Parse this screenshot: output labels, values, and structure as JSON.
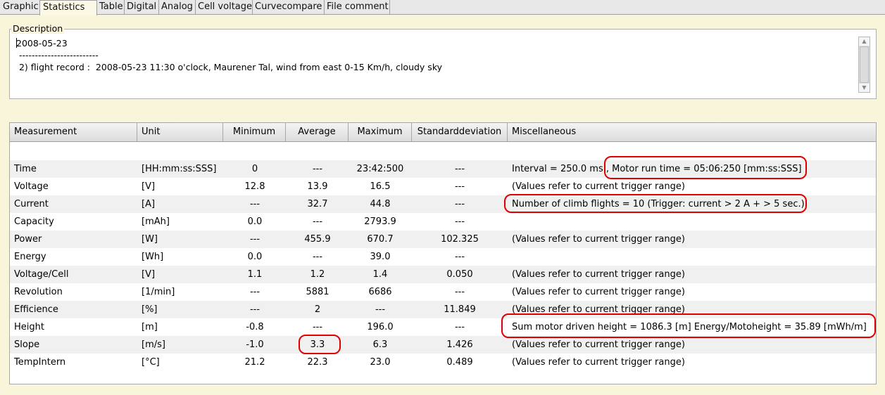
{
  "tabs": [
    {
      "label": "Graphic"
    },
    {
      "label": "Statistics"
    },
    {
      "label": "Table"
    },
    {
      "label": "Digital"
    },
    {
      "label": "Analog"
    },
    {
      "label": "Cell voltage"
    },
    {
      "label": "Curvecompare"
    },
    {
      "label": "File comment"
    }
  ],
  "active_tab": "Statistics",
  "description": {
    "legend": "Description",
    "text": "2008-05-23\n -------------------------\n 2) flight record :  2008-05-23 11:30 o'clock, Maurener Tal, wind from east 0-15 Km/h, cloudy sky"
  },
  "table": {
    "headers": [
      "Measurement",
      "Unit",
      "Minimum",
      "Average",
      "Maximum",
      "Standarddeviation",
      "Miscellaneous"
    ],
    "rows": [
      {
        "measurement": "Time",
        "unit": "[HH:mm:ss:SSS]",
        "min": "0",
        "avg": "---",
        "max": "23:42:500",
        "std": "---",
        "misc": "Interval =  250.0 ms , Motor run time = 05:06:250 [mm:ss:SSS]"
      },
      {
        "measurement": "Voltage",
        "unit": "[V]",
        "min": "12.8",
        "avg": "13.9",
        "max": "16.5",
        "std": "---",
        "misc": "(Values refer to current trigger range)"
      },
      {
        "measurement": "Current",
        "unit": "[A]",
        "min": "---",
        "avg": "32.7",
        "max": "44.8",
        "std": "---",
        "misc": "Number of climb flights = 10 (Trigger: current > 2 A + > 5 sec.)"
      },
      {
        "measurement": "Capacity",
        "unit": "[mAh]",
        "min": "0.0",
        "avg": "---",
        "max": "2793.9",
        "std": "---",
        "misc": ""
      },
      {
        "measurement": "Power",
        "unit": "[W]",
        "min": "---",
        "avg": "455.9",
        "max": "670.7",
        "std": "102.325",
        "misc": "(Values refer to current trigger range)"
      },
      {
        "measurement": "Energy",
        "unit": "[Wh]",
        "min": "0.0",
        "avg": "---",
        "max": "39.0",
        "std": "---",
        "misc": ""
      },
      {
        "measurement": "Voltage/Cell",
        "unit": "[V]",
        "min": "1.1",
        "avg": "1.2",
        "max": "1.4",
        "std": "0.050",
        "misc": "(Values refer to current trigger range)"
      },
      {
        "measurement": "Revolution",
        "unit": "[1/min]",
        "min": "---",
        "avg": "5881",
        "max": "6686",
        "std": "---",
        "misc": "(Values refer to current trigger range)"
      },
      {
        "measurement": "Efficience",
        "unit": "[%]",
        "min": "---",
        "avg": "2",
        "max": "---",
        "std": "11.849",
        "misc": "(Values refer to current trigger range)"
      },
      {
        "measurement": "Height",
        "unit": "[m]",
        "min": "-0.8",
        "avg": "---",
        "max": "196.0",
        "std": "---",
        "misc": "Sum motor driven height = 1086.3 [m]   Energy/Motoheight = 35.89 [mWh/m]"
      },
      {
        "measurement": "Slope",
        "unit": "[m/s]",
        "min": "-1.0",
        "avg": "3.3",
        "max": "6.3",
        "std": "1.426",
        "misc": "(Values refer to current trigger range)"
      },
      {
        "measurement": "TempIntern",
        "unit": "[°C]",
        "min": "21.2",
        "avg": "22.3",
        "max": "23.0",
        "std": "0.489",
        "misc": "(Values refer to current trigger range)"
      }
    ]
  },
  "colors": {
    "highlight": "#e00000",
    "background": "#f8f5da"
  }
}
